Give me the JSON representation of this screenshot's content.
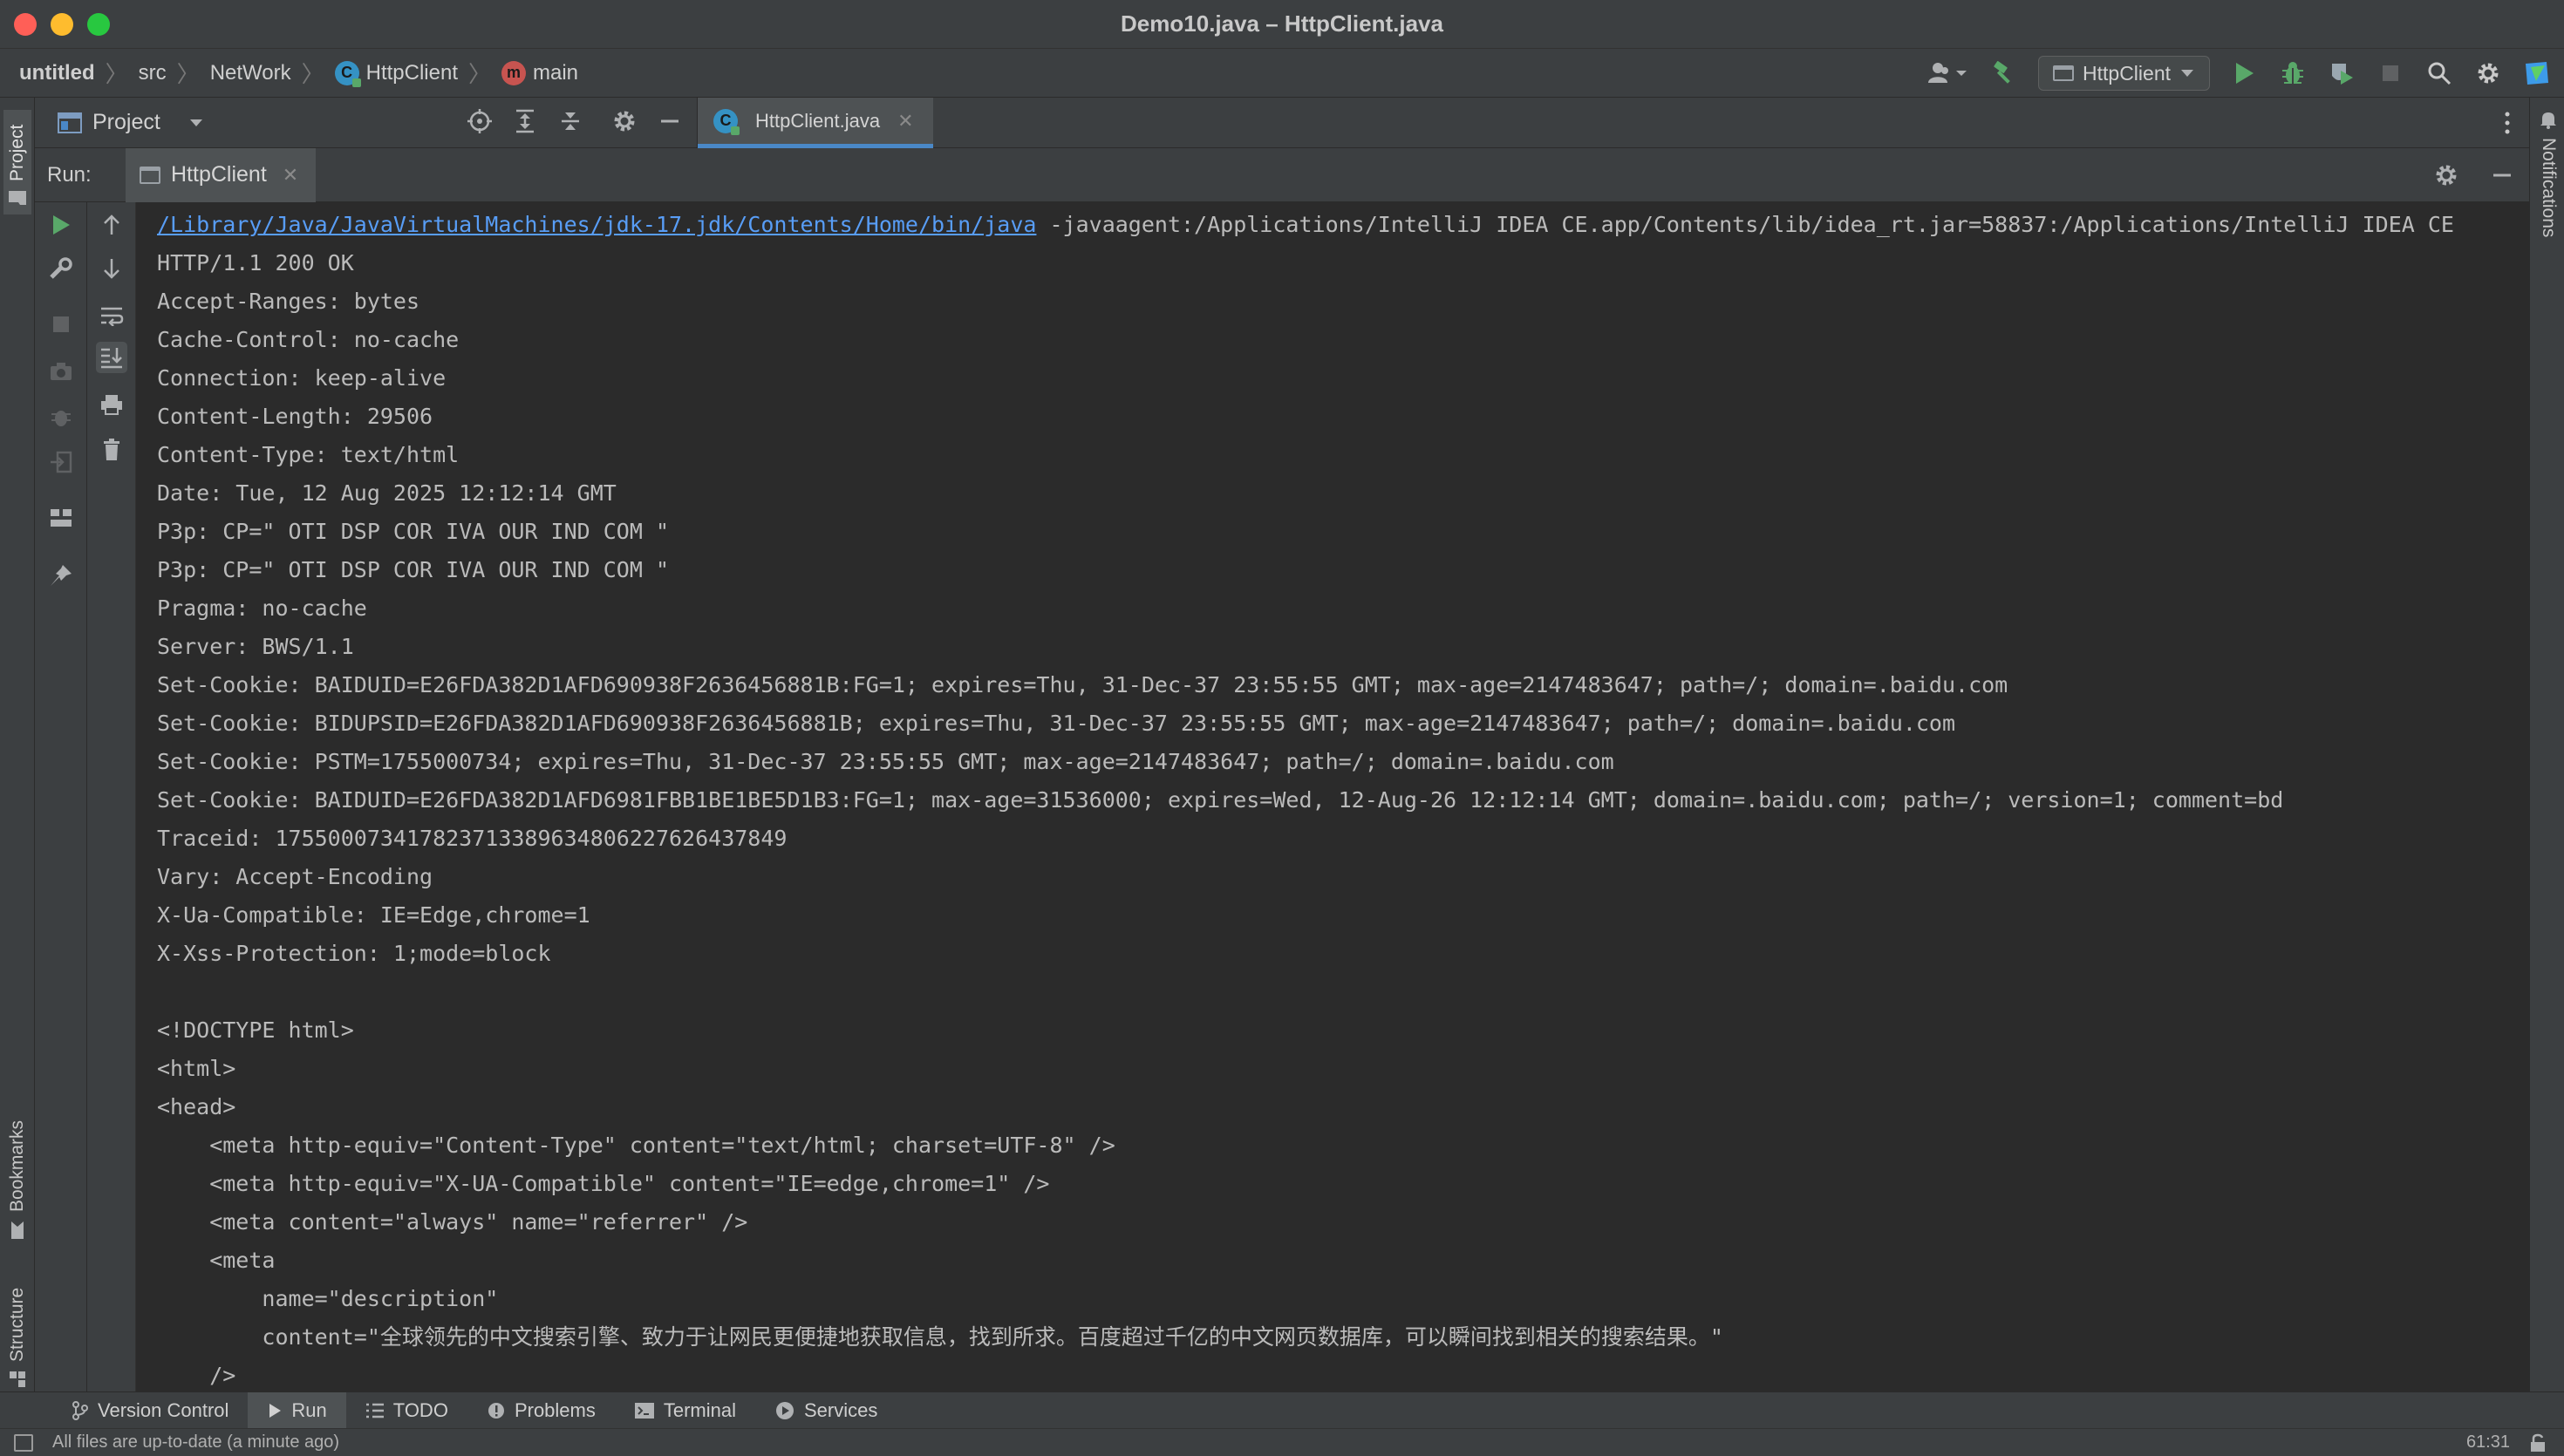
{
  "window": {
    "title": "Demo10.java – HttpClient.java"
  },
  "breadcrumbs": [
    {
      "label": "untitled"
    },
    {
      "label": "src"
    },
    {
      "label": "NetWork"
    },
    {
      "label": "HttpClient"
    },
    {
      "label": "main"
    }
  ],
  "toolbar": {
    "run_config": "HttpClient"
  },
  "project_panel": {
    "title": "Project"
  },
  "editor": {
    "active_tab": "HttpClient.java"
  },
  "side_tabs": {
    "project": "Project",
    "bookmarks": "Bookmarks",
    "structure": "Structure",
    "notifications": "Notifications"
  },
  "run": {
    "label": "Run:",
    "tab": "HttpClient",
    "java_path": "/Library/Java/JavaVirtualMachines/jdk-17.jdk/Contents/Home/bin/java",
    "java_args": " -javaagent:/Applications/IntelliJ IDEA CE.app/Contents/lib/idea_rt.jar=58837:/Applications/IntelliJ IDEA CE",
    "output": [
      "HTTP/1.1 200 OK",
      "Accept-Ranges: bytes",
      "Cache-Control: no-cache",
      "Connection: keep-alive",
      "Content-Length: 29506",
      "Content-Type: text/html",
      "Date: Tue, 12 Aug 2025 12:12:14 GMT",
      "P3p: CP=\" OTI DSP COR IVA OUR IND COM \"",
      "P3p: CP=\" OTI DSP COR IVA OUR IND COM \"",
      "Pragma: no-cache",
      "Server: BWS/1.1",
      "Set-Cookie: BAIDUID=E26FDA382D1AFD690938F2636456881B:FG=1; expires=Thu, 31-Dec-37 23:55:55 GMT; max-age=2147483647; path=/; domain=.baidu.com",
      "Set-Cookie: BIDUPSID=E26FDA382D1AFD690938F2636456881B; expires=Thu, 31-Dec-37 23:55:55 GMT; max-age=2147483647; path=/; domain=.baidu.com",
      "Set-Cookie: PSTM=1755000734; expires=Thu, 31-Dec-37 23:55:55 GMT; max-age=2147483647; path=/; domain=.baidu.com",
      "Set-Cookie: BAIDUID=E26FDA382D1AFD6981FBB1BE1BE5D1B3:FG=1; max-age=31536000; expires=Wed, 12-Aug-26 12:12:14 GMT; domain=.baidu.com; path=/; version=1; comment=bd",
      "Traceid: 175500073417823713389634806227626437849",
      "Vary: Accept-Encoding",
      "X-Ua-Compatible: IE=Edge,chrome=1",
      "X-Xss-Protection: 1;mode=block",
      "",
      "<!DOCTYPE html>",
      "<html>",
      "<head>",
      "    <meta http-equiv=\"Content-Type\" content=\"text/html; charset=UTF-8\" />",
      "    <meta http-equiv=\"X-UA-Compatible\" content=\"IE=edge,chrome=1\" />",
      "    <meta content=\"always\" name=\"referrer\" />",
      "    <meta",
      "        name=\"description\"",
      "        content=\"全球领先的中文搜索引擎、致力于让网民更便捷地获取信息，找到所求。百度超过千亿的中文网页数据库，可以瞬间找到相关的搜索结果。\"",
      "    />"
    ]
  },
  "bottom_tabs": [
    {
      "label": "Version Control"
    },
    {
      "label": "Run"
    },
    {
      "label": "TODO"
    },
    {
      "label": "Problems"
    },
    {
      "label": "Terminal"
    },
    {
      "label": "Services"
    }
  ],
  "status": {
    "message": "All files are up-to-date (a minute ago)",
    "cursor": "61:31"
  },
  "colors": {
    "background": "#2b2b2b",
    "panel": "#3c3f41",
    "link": "#589df6",
    "run_green": "#59a869",
    "accent": "#4a88c7"
  }
}
